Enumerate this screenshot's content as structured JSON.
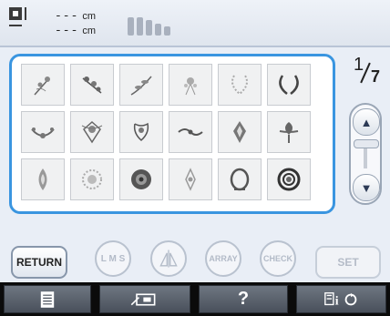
{
  "topbar": {
    "width_value": "---",
    "height_value": "---",
    "unit": "cm",
    "size_icon": "pattern-size-icon",
    "thread_icon": "thread-spools-icon"
  },
  "grid": {
    "icons": [
      "floral-spray-icon",
      "flower-branch-icon",
      "leaf-vine-icon",
      "small-bouquet-icon",
      "floral-wreath-open-icon",
      "laurel-wreath-icon",
      "floral-swag-icon",
      "ornamental-crest-icon",
      "filigree-ornament-icon",
      "scroll-border-icon",
      "damask-motif-icon",
      "fleur-ornament-icon",
      "teardrop-ornament-icon",
      "round-medallion-icon",
      "baroque-medallion-icon",
      "diamond-flourish-icon",
      "oval-laurel-wreath-icon",
      "round-frame-icon"
    ]
  },
  "pagination": {
    "current": "1",
    "total": "7",
    "up_icon": "up-arrow-icon",
    "down_icon": "down-arrow-icon"
  },
  "buttons": {
    "return": "RETURN",
    "lms": "L M S",
    "mirror_icon": "mirror-flip-icon",
    "array": "ARRAY",
    "check": "CHECK",
    "set": "SET"
  },
  "bottombar": {
    "help": "?",
    "icons": [
      "document-icon",
      "embroidery-frame-icon",
      "help-icon",
      "settings-info-icon"
    ]
  },
  "colors": {
    "accent": "#3a95e0",
    "background": "#e9eef6",
    "bottom_bar": "#0b0b0b"
  }
}
